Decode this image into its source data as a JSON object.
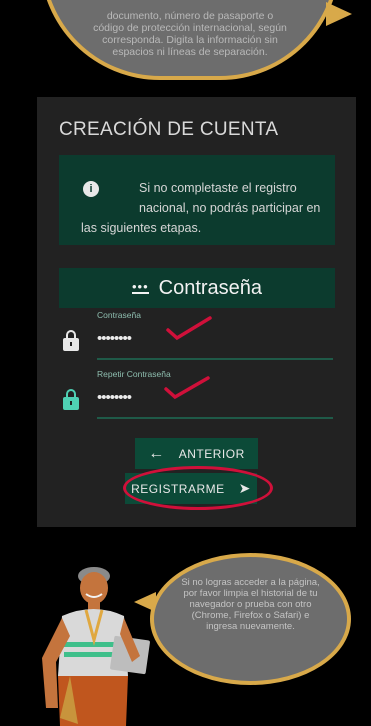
{
  "top_bubble": {
    "lines": [
      "documento, número de pasaporte o",
      "código de protección internacional, según",
      "corresponda. Digita la información sin",
      "espacios ni líneas de separación."
    ]
  },
  "card": {
    "title": "CREACIÓN DE CUENTA",
    "notice": {
      "line1": "Si no completaste el registro",
      "line2": "nacional, no podrás participar en",
      "line3": "las siguientes etapas."
    },
    "section_title": "Contraseña",
    "password": {
      "label": "Contraseña",
      "value": "••••••••"
    },
    "repeat_password": {
      "label": "Repetir Contraseña",
      "value": "••••••••"
    },
    "prev_button": "ANTERIOR",
    "register_button": "REGISTRARME"
  },
  "bottom_bubble": {
    "lines": [
      "Si no logras acceder a la página,",
      "por favor limpia el historial de tu",
      "navegador o prueba con otro",
      "(Chrome, Firefox o Safari) e",
      "ingresa nuevamente."
    ]
  },
  "colors": {
    "dark_green": "#0c3b2e",
    "annotation_red": "#d0103a",
    "bubble_border": "#d8a94a",
    "card_bg": "#222222"
  }
}
